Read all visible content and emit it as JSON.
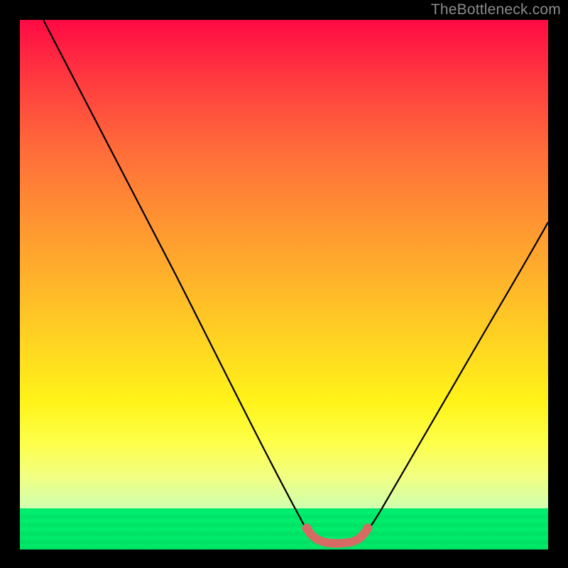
{
  "watermark": "TheBottleneck.com",
  "chart_data": {
    "type": "line",
    "title": "",
    "xlabel": "",
    "ylabel": "",
    "xlim": [
      0,
      1
    ],
    "ylim": [
      0,
      1
    ],
    "series": [
      {
        "name": "bottleneck-curve",
        "x": [
          0.045,
          0.1,
          0.16,
          0.22,
          0.28,
          0.34,
          0.4,
          0.46,
          0.5,
          0.545,
          0.555,
          0.565,
          0.585,
          0.605,
          0.625,
          0.645,
          0.652,
          0.7,
          0.76,
          0.82,
          0.88,
          0.94,
          1.0
        ],
        "y": [
          1.0,
          0.885,
          0.77,
          0.655,
          0.54,
          0.42,
          0.3,
          0.175,
          0.093,
          0.027,
          0.018,
          0.014,
          0.01,
          0.01,
          0.014,
          0.02,
          0.027,
          0.085,
          0.175,
          0.275,
          0.385,
          0.5,
          0.62
        ]
      },
      {
        "name": "flat-segment-marker",
        "x": [
          0.545,
          0.555,
          0.565,
          0.585,
          0.605,
          0.625,
          0.645,
          0.652
        ],
        "y": [
          0.027,
          0.018,
          0.014,
          0.01,
          0.01,
          0.014,
          0.02,
          0.027
        ]
      }
    ],
    "colors": {
      "curve": "#000000",
      "marker": "#d66b66",
      "gradient_top": "#ff0a44",
      "gradient_bottom": "#00dc61"
    }
  }
}
